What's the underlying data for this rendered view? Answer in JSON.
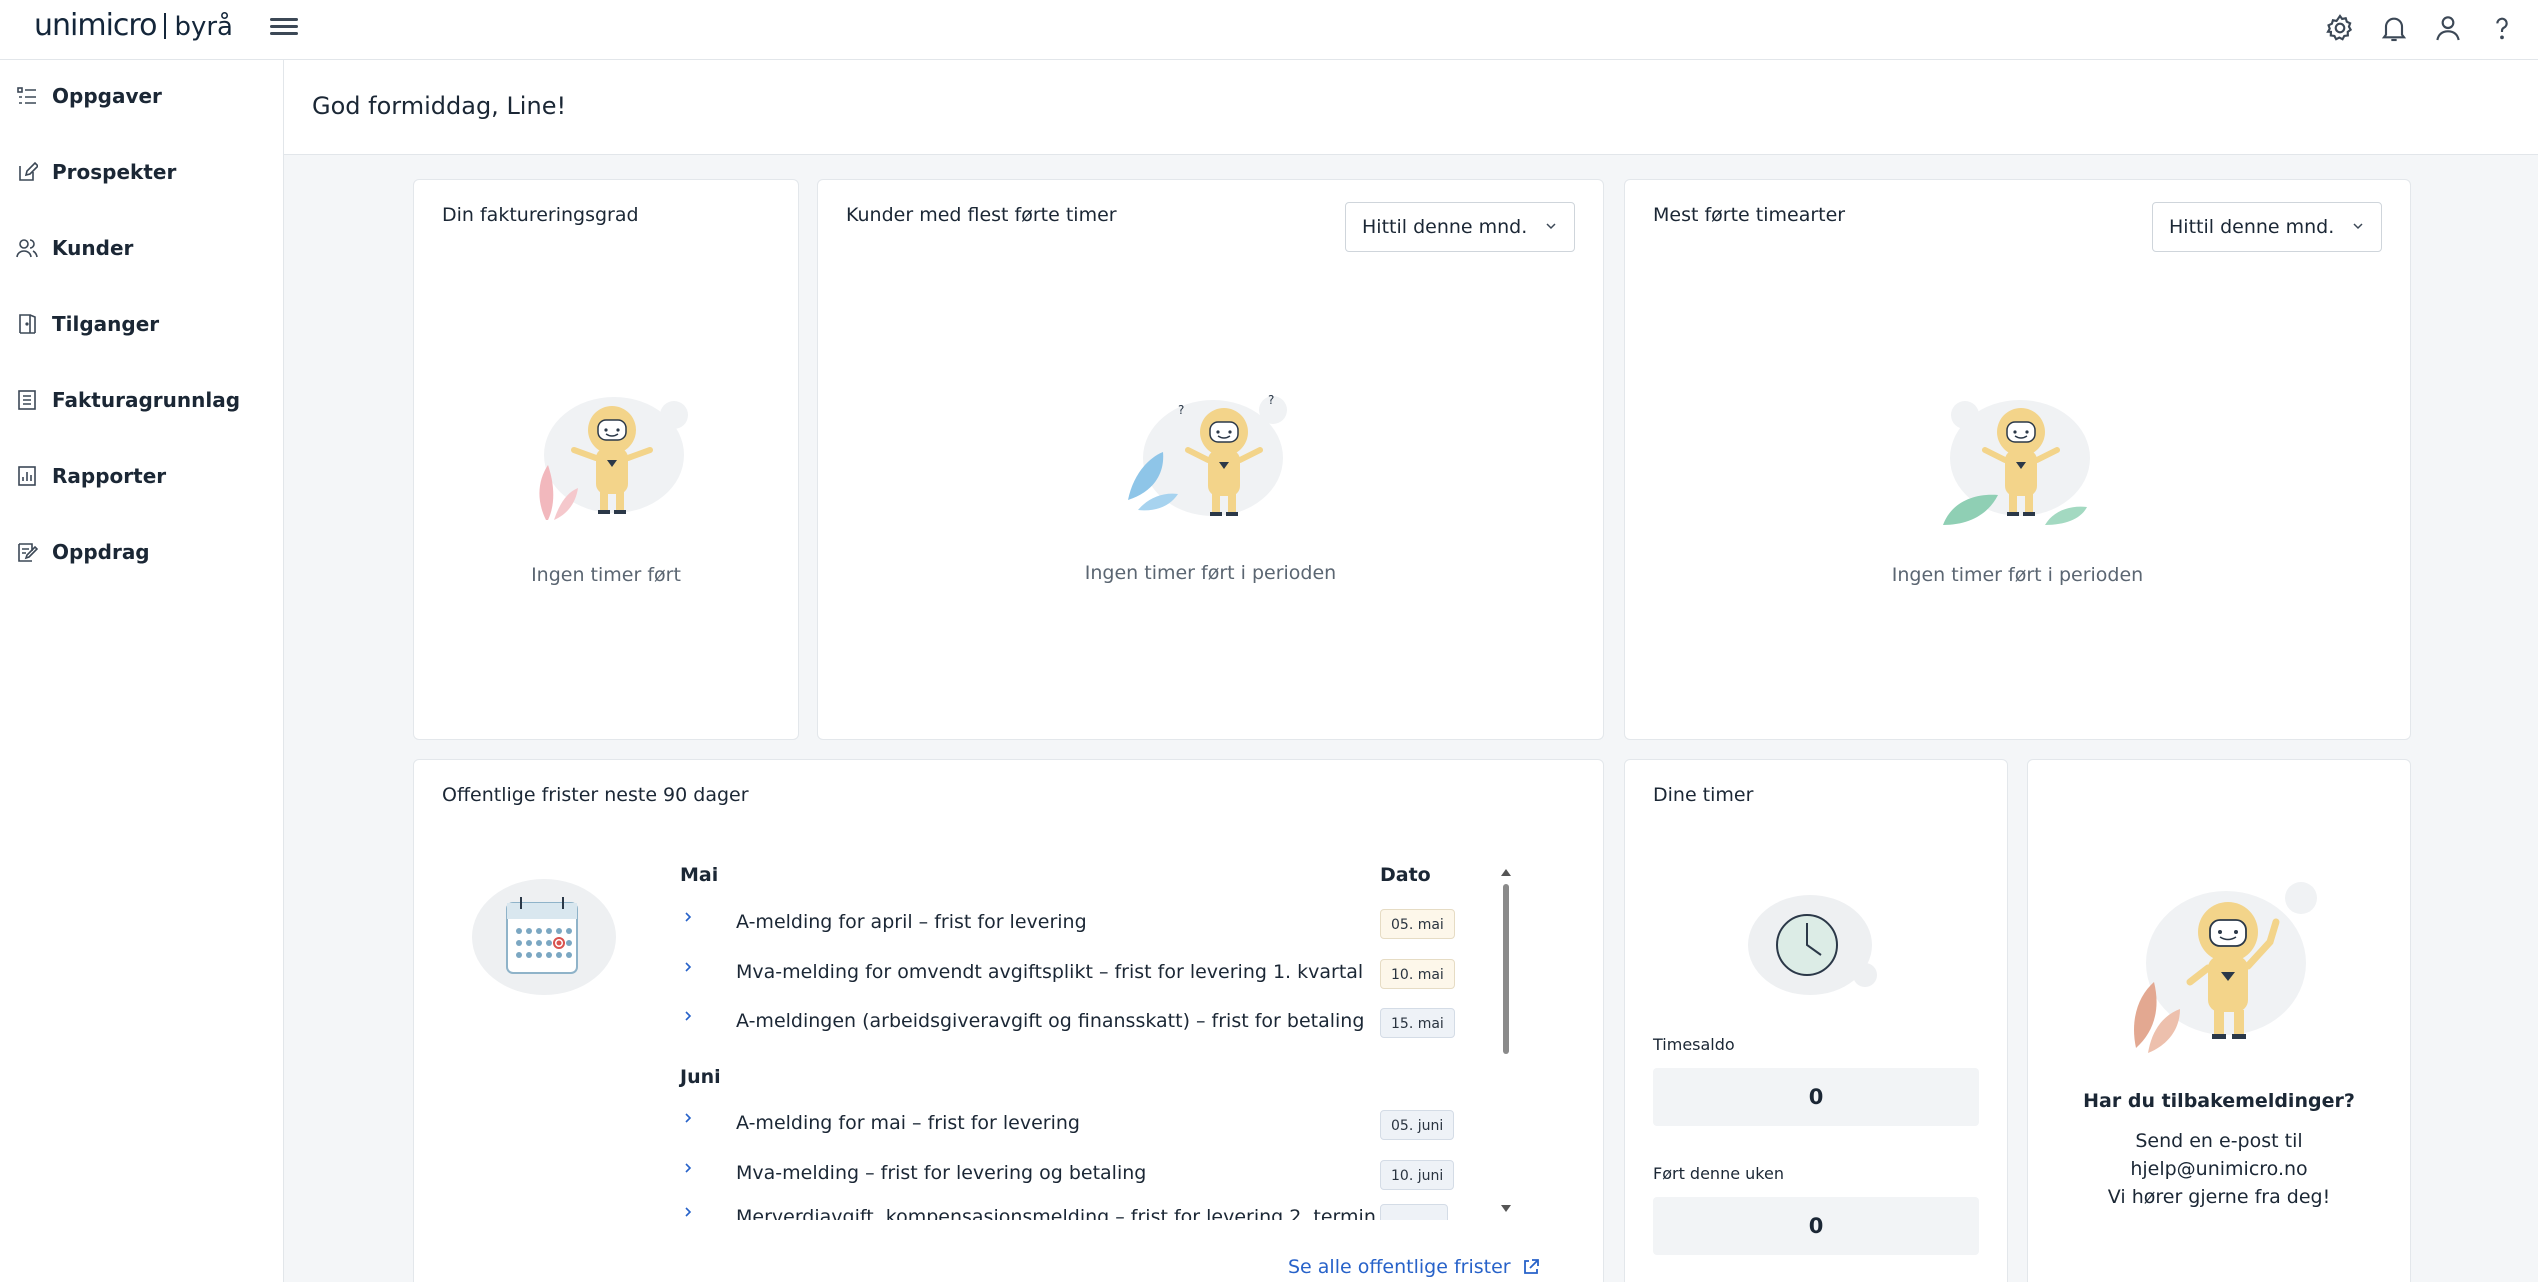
{
  "header": {
    "brand": "unimicro",
    "product": "byrå",
    "icons": [
      "gear-icon",
      "bell-icon",
      "user-icon",
      "help-icon"
    ]
  },
  "sidebar": {
    "items": [
      {
        "label": "Oppgaver",
        "icon": "task-list-icon"
      },
      {
        "label": "Prospekter",
        "icon": "edit-document-icon"
      },
      {
        "label": "Kunder",
        "icon": "users-icon"
      },
      {
        "label": "Tilganger",
        "icon": "door-icon"
      },
      {
        "label": "Fakturagrunnlag",
        "icon": "invoice-icon"
      },
      {
        "label": "Rapporter",
        "icon": "report-chart-icon"
      },
      {
        "label": "Oppdrag",
        "icon": "assignment-icon"
      }
    ]
  },
  "page": {
    "greeting": "God formiddag, Line!"
  },
  "cards": {
    "billing": {
      "title": "Din faktureringsgrad",
      "empty": "Ingen timer ført"
    },
    "customers": {
      "title": "Kunder med flest førte timer",
      "dropdown": "Hittil denne mnd.",
      "empty": "Ingen timer ført i perioden"
    },
    "hourtypes": {
      "title": "Mest førte timearter",
      "dropdown": "Hittil denne mnd.",
      "empty": "Ingen timer ført i perioden"
    },
    "deadlines": {
      "title": "Offentlige frister neste 90 dager",
      "date_header": "Dato",
      "months": [
        {
          "name": "Mai",
          "rows": [
            {
              "text": "A-melding for april – frist for levering",
              "date": "05. mai"
            },
            {
              "text": "Mva-melding for omvendt avgiftsplikt – frist for levering 1. kvartal",
              "date": "10. mai"
            },
            {
              "text": "A-meldingen (arbeidsgiveravgift og finansskatt) – frist for betaling",
              "date": "15. mai"
            }
          ]
        },
        {
          "name": "Juni",
          "rows": [
            {
              "text": "A-melding for mai – frist for levering",
              "date": "05. juni"
            },
            {
              "text": "Mva-melding – frist for levering og betaling",
              "date": "10. juni"
            },
            {
              "text": "Merverdiavgift, kompensasjonsmelding – frist for levering 2. termin",
              "date": ""
            }
          ]
        }
      ],
      "see_all": "Se alle offentlige frister"
    },
    "mytime": {
      "title": "Dine timer",
      "balance_label": "Timesaldo",
      "balance_value": "0",
      "week_label": "Ført denne uken",
      "week_value": "0"
    },
    "feedback": {
      "title": "Har du tilbakemeldinger?",
      "line1": "Send en e-post til",
      "email": "hjelp@unimicro.no",
      "line3": "Vi hører gjerne fra deg!"
    }
  }
}
